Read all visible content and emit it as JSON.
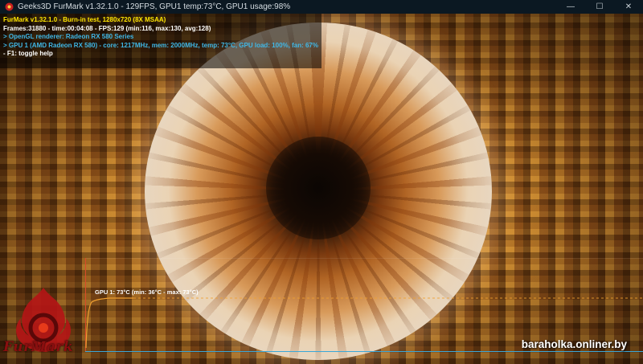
{
  "window": {
    "title": "Geeks3D FurMark v1.32.1.0 - 129FPS, GPU1 temp:73°C, GPU1 usage:98%",
    "icon": "furmark-app-icon",
    "controls": {
      "minimize": "—",
      "maximize": "☐",
      "close": "✕"
    }
  },
  "overlay": {
    "title_line": "FurMark v1.32.1.0 - Burn-in test, 1280x720 (8X MSAA)",
    "frames_line": "Frames:31880 - time:00:04:08 - FPS:129 (min:116, max:130, avg:128)",
    "renderer_line": "> OpenGL renderer: Radeon RX 580 Series",
    "gpu_line": "> GPU 1 (AMD Radeon RX 580) - core: 1217MHz, mem: 2000MHz, temp: 73°C, GPU load: 100%, fan: 67%",
    "help_line": "- F1: toggle help"
  },
  "temperature_graph": {
    "label": "GPU 1: 73°C (min: 36°C - max: 73°C)",
    "current": 73,
    "min": 36,
    "max": 73,
    "unit": "°C"
  },
  "logo": {
    "text": "FurMark",
    "icon": "furmark-flame-logo"
  },
  "watermark": "baraholka.onliner.by",
  "colors": {
    "titlebar_bg": "#0b1822",
    "text_yellow": "#ffe600",
    "text_cyan": "#3fb8e8",
    "graph_axis_red": "#d94b2a",
    "graph_axis_blue": "#3aa7d8",
    "graph_line_orange": "#f0a030"
  }
}
